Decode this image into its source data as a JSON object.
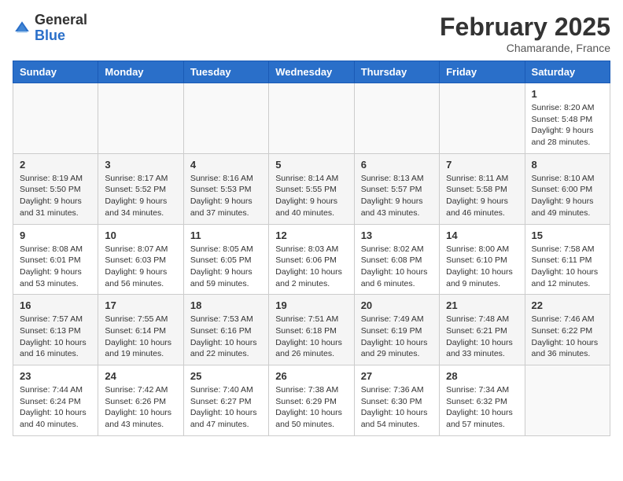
{
  "header": {
    "logo_general": "General",
    "logo_blue": "Blue",
    "month": "February 2025",
    "location": "Chamarande, France"
  },
  "days_of_week": [
    "Sunday",
    "Monday",
    "Tuesday",
    "Wednesday",
    "Thursday",
    "Friday",
    "Saturday"
  ],
  "weeks": [
    [
      {
        "day": "",
        "info": ""
      },
      {
        "day": "",
        "info": ""
      },
      {
        "day": "",
        "info": ""
      },
      {
        "day": "",
        "info": ""
      },
      {
        "day": "",
        "info": ""
      },
      {
        "day": "",
        "info": ""
      },
      {
        "day": "1",
        "info": "Sunrise: 8:20 AM\nSunset: 5:48 PM\nDaylight: 9 hours and 28 minutes."
      }
    ],
    [
      {
        "day": "2",
        "info": "Sunrise: 8:19 AM\nSunset: 5:50 PM\nDaylight: 9 hours and 31 minutes."
      },
      {
        "day": "3",
        "info": "Sunrise: 8:17 AM\nSunset: 5:52 PM\nDaylight: 9 hours and 34 minutes."
      },
      {
        "day": "4",
        "info": "Sunrise: 8:16 AM\nSunset: 5:53 PM\nDaylight: 9 hours and 37 minutes."
      },
      {
        "day": "5",
        "info": "Sunrise: 8:14 AM\nSunset: 5:55 PM\nDaylight: 9 hours and 40 minutes."
      },
      {
        "day": "6",
        "info": "Sunrise: 8:13 AM\nSunset: 5:57 PM\nDaylight: 9 hours and 43 minutes."
      },
      {
        "day": "7",
        "info": "Sunrise: 8:11 AM\nSunset: 5:58 PM\nDaylight: 9 hours and 46 minutes."
      },
      {
        "day": "8",
        "info": "Sunrise: 8:10 AM\nSunset: 6:00 PM\nDaylight: 9 hours and 49 minutes."
      }
    ],
    [
      {
        "day": "9",
        "info": "Sunrise: 8:08 AM\nSunset: 6:01 PM\nDaylight: 9 hours and 53 minutes."
      },
      {
        "day": "10",
        "info": "Sunrise: 8:07 AM\nSunset: 6:03 PM\nDaylight: 9 hours and 56 minutes."
      },
      {
        "day": "11",
        "info": "Sunrise: 8:05 AM\nSunset: 6:05 PM\nDaylight: 9 hours and 59 minutes."
      },
      {
        "day": "12",
        "info": "Sunrise: 8:03 AM\nSunset: 6:06 PM\nDaylight: 10 hours and 2 minutes."
      },
      {
        "day": "13",
        "info": "Sunrise: 8:02 AM\nSunset: 6:08 PM\nDaylight: 10 hours and 6 minutes."
      },
      {
        "day": "14",
        "info": "Sunrise: 8:00 AM\nSunset: 6:10 PM\nDaylight: 10 hours and 9 minutes."
      },
      {
        "day": "15",
        "info": "Sunrise: 7:58 AM\nSunset: 6:11 PM\nDaylight: 10 hours and 12 minutes."
      }
    ],
    [
      {
        "day": "16",
        "info": "Sunrise: 7:57 AM\nSunset: 6:13 PM\nDaylight: 10 hours and 16 minutes."
      },
      {
        "day": "17",
        "info": "Sunrise: 7:55 AM\nSunset: 6:14 PM\nDaylight: 10 hours and 19 minutes."
      },
      {
        "day": "18",
        "info": "Sunrise: 7:53 AM\nSunset: 6:16 PM\nDaylight: 10 hours and 22 minutes."
      },
      {
        "day": "19",
        "info": "Sunrise: 7:51 AM\nSunset: 6:18 PM\nDaylight: 10 hours and 26 minutes."
      },
      {
        "day": "20",
        "info": "Sunrise: 7:49 AM\nSunset: 6:19 PM\nDaylight: 10 hours and 29 minutes."
      },
      {
        "day": "21",
        "info": "Sunrise: 7:48 AM\nSunset: 6:21 PM\nDaylight: 10 hours and 33 minutes."
      },
      {
        "day": "22",
        "info": "Sunrise: 7:46 AM\nSunset: 6:22 PM\nDaylight: 10 hours and 36 minutes."
      }
    ],
    [
      {
        "day": "23",
        "info": "Sunrise: 7:44 AM\nSunset: 6:24 PM\nDaylight: 10 hours and 40 minutes."
      },
      {
        "day": "24",
        "info": "Sunrise: 7:42 AM\nSunset: 6:26 PM\nDaylight: 10 hours and 43 minutes."
      },
      {
        "day": "25",
        "info": "Sunrise: 7:40 AM\nSunset: 6:27 PM\nDaylight: 10 hours and 47 minutes."
      },
      {
        "day": "26",
        "info": "Sunrise: 7:38 AM\nSunset: 6:29 PM\nDaylight: 10 hours and 50 minutes."
      },
      {
        "day": "27",
        "info": "Sunrise: 7:36 AM\nSunset: 6:30 PM\nDaylight: 10 hours and 54 minutes."
      },
      {
        "day": "28",
        "info": "Sunrise: 7:34 AM\nSunset: 6:32 PM\nDaylight: 10 hours and 57 minutes."
      },
      {
        "day": "",
        "info": ""
      }
    ]
  ]
}
